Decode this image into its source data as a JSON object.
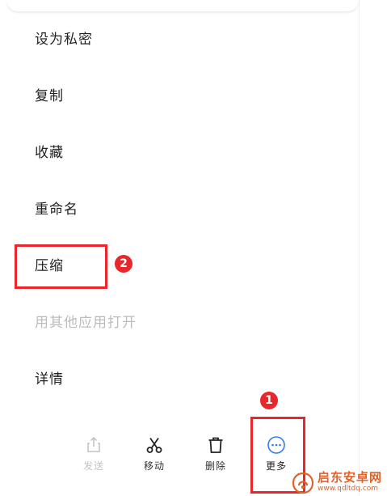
{
  "menu": {
    "items": [
      {
        "label": "设为私密",
        "enabled": true
      },
      {
        "label": "复制",
        "enabled": true
      },
      {
        "label": "收藏",
        "enabled": true
      },
      {
        "label": "重命名",
        "enabled": true
      },
      {
        "label": "压缩",
        "enabled": true
      },
      {
        "label": "用其他应用打开",
        "enabled": false
      },
      {
        "label": "详情",
        "enabled": true
      }
    ]
  },
  "toolbar": {
    "send_label": "发送",
    "move_label": "移动",
    "delete_label": "删除",
    "more_label": "更多"
  },
  "annotations": {
    "step1": "1",
    "step2": "2",
    "color": "#e8262b"
  },
  "watermark": {
    "title": "启东安卓网",
    "url": "www.qdltdq.com"
  },
  "colors": {
    "accent": "#2f7cf6",
    "text": "#222222",
    "disabled": "#bcbcbc"
  }
}
